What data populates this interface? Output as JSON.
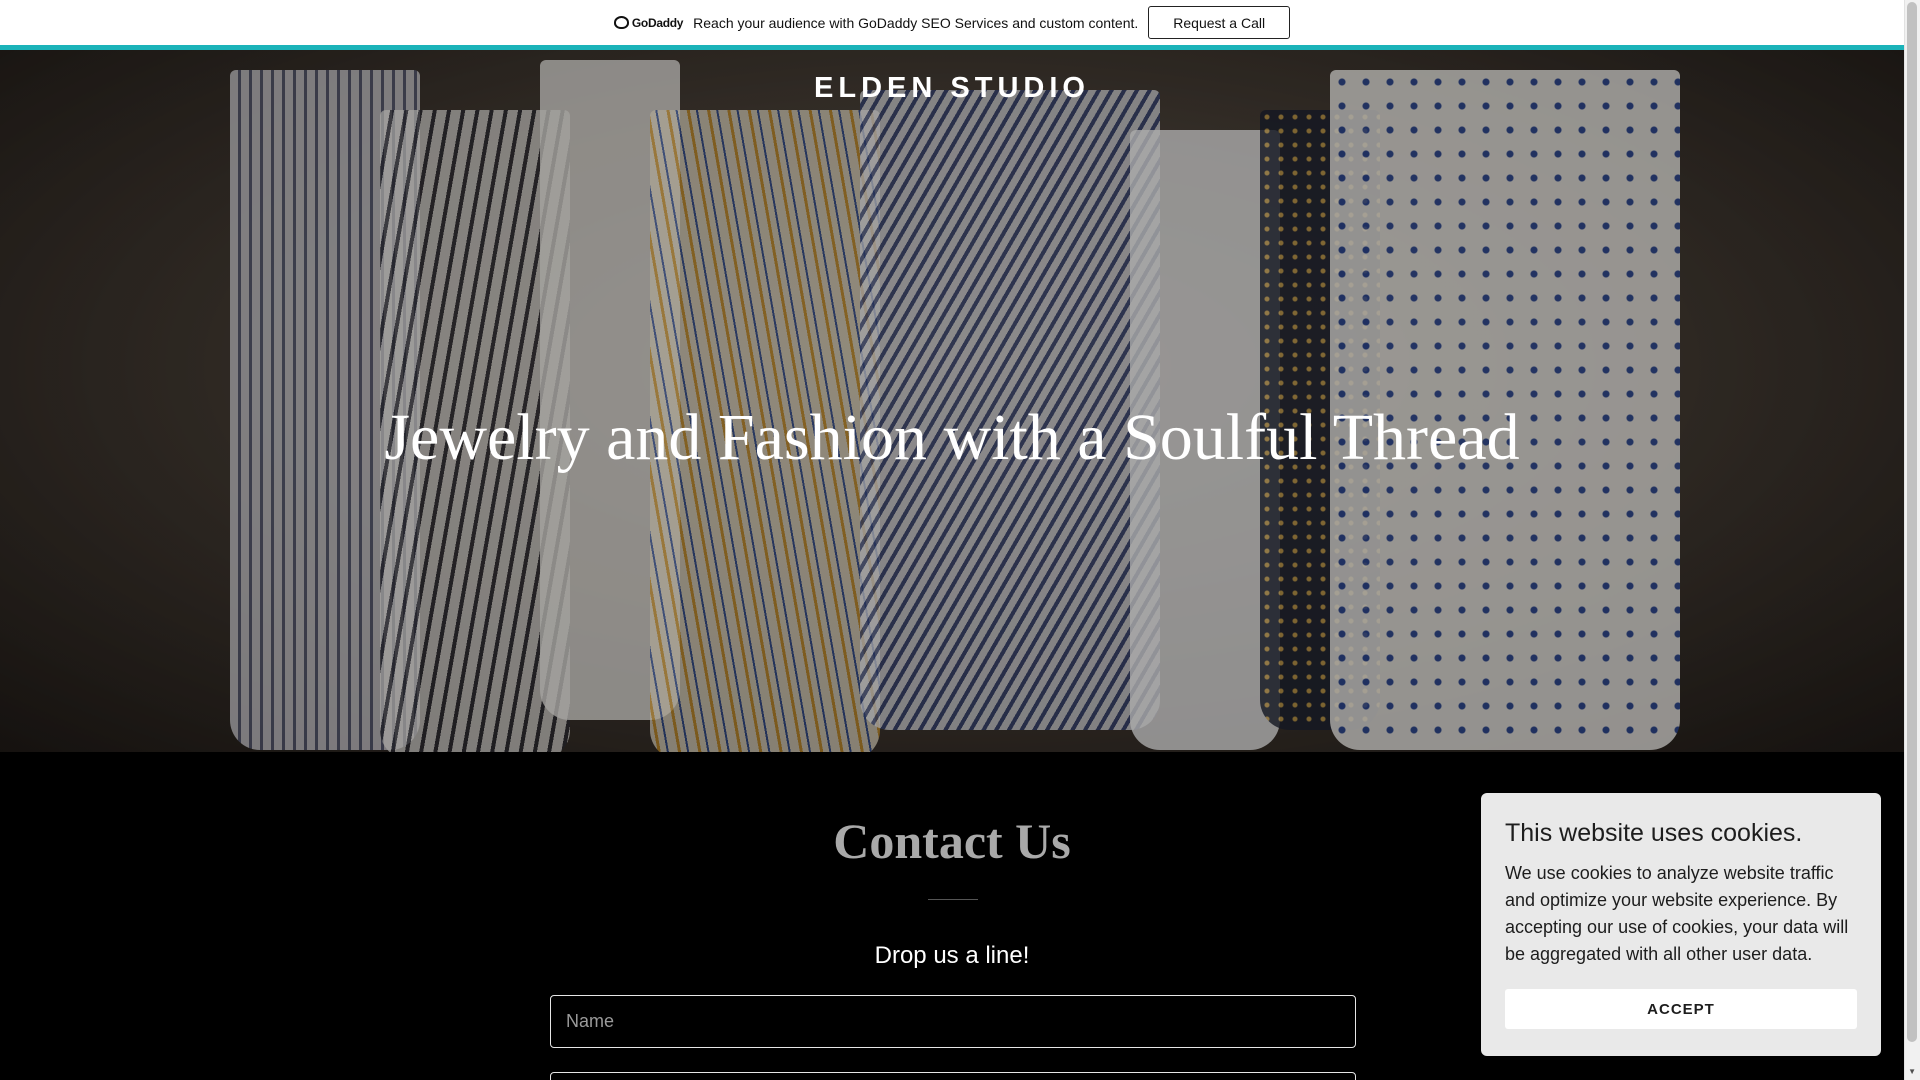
{
  "promo": {
    "logo_text": "GoDaddy",
    "message": "Reach your audience with GoDaddy SEO Services and custom content.",
    "button_label": "Request a Call",
    "accent_color": "#1bb3b9"
  },
  "hero": {
    "brand": "ELDEN STUDIO",
    "title": "Jewelry and Fashion with a Soulful Thread"
  },
  "contact": {
    "title": "Contact Us",
    "subtitle": "Drop us a line!",
    "name_placeholder": "Name"
  },
  "cookie_banner": {
    "title": "This website uses cookies.",
    "body": "We use cookies to analyze website traffic and optimize your website experience. By accepting our use of cookies, your data will be aggregated with all other user data.",
    "accept_label": "ACCEPT"
  }
}
